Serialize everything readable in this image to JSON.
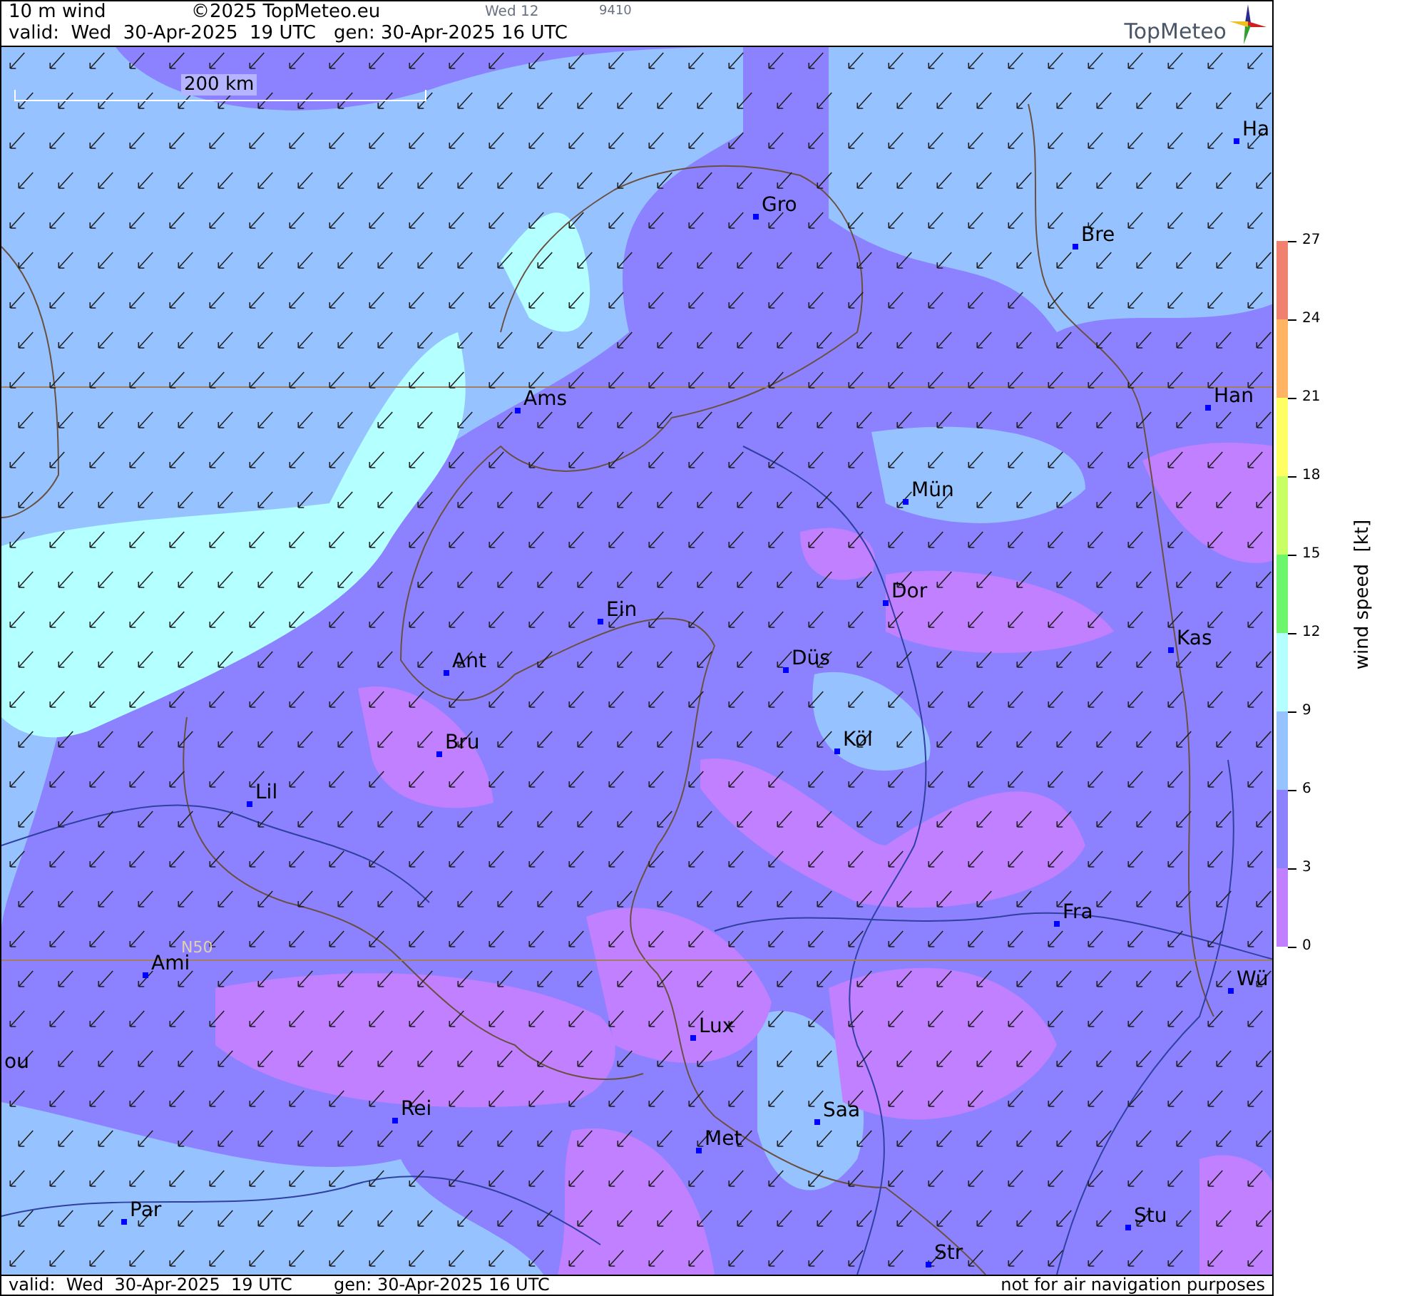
{
  "header": {
    "product": "10 m wind",
    "copyright": "©2025 TopMeteo.eu",
    "day": "Wed 12",
    "code": "9410",
    "valid": "valid:  Wed  30-Apr-2025  19 UTC",
    "generated": "gen: 30-Apr-2025 16 UTC",
    "logo": "TopMeteo"
  },
  "map": {
    "scale": "200 km",
    "latitude_label": "N50",
    "cities": [
      {
        "name": "Ha"
      },
      {
        "name": "Gro"
      },
      {
        "name": "Bre"
      },
      {
        "name": "Ams"
      },
      {
        "name": "Han"
      },
      {
        "name": "Mün"
      },
      {
        "name": "Dor"
      },
      {
        "name": "Ein"
      },
      {
        "name": "Kas"
      },
      {
        "name": "Düs"
      },
      {
        "name": "Ant"
      },
      {
        "name": "Köl"
      },
      {
        "name": "Bru"
      },
      {
        "name": "Lil"
      },
      {
        "name": "Fra"
      },
      {
        "name": "Ami"
      },
      {
        "name": "Wü"
      },
      {
        "name": "Lux"
      },
      {
        "name": "ou"
      },
      {
        "name": "Rei"
      },
      {
        "name": "Saa"
      },
      {
        "name": "Met"
      },
      {
        "name": "Par"
      },
      {
        "name": "Stu"
      },
      {
        "name": "Str"
      }
    ]
  },
  "legend": {
    "title": "wind speed  [kt]",
    "bins": [
      {
        "color": "#f08070"
      },
      {
        "color": "#ffb464"
      },
      {
        "color": "#ffff64"
      },
      {
        "color": "#c8ff64"
      },
      {
        "color": "#6cf66c"
      },
      {
        "color": "#b4ffff"
      },
      {
        "color": "#96c3ff"
      },
      {
        "color": "#8c82ff"
      },
      {
        "color": "#c080ff"
      }
    ],
    "ticks": [
      "27",
      "24",
      "21",
      "18",
      "15",
      "12",
      "9",
      "6",
      "3",
      "0"
    ]
  },
  "footer": {
    "valid": "valid:  Wed  30-Apr-2025  19 UTC",
    "generated": "gen: 30-Apr-2025 16 UTC",
    "disclaimer": "not for air navigation purposes"
  }
}
